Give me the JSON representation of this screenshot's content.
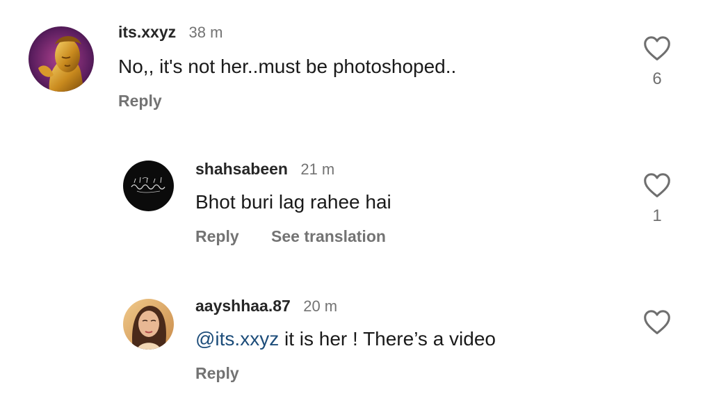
{
  "comments": [
    {
      "username": "its.xxyz",
      "time": "38 m",
      "text": "No,, it's not her..must be photoshoped..",
      "reply_label": "Reply",
      "like_count": "6",
      "avatar_icon": "golden-buddha-avatar"
    },
    {
      "username": "shahsabeen",
      "time": "21 m",
      "text": "Bhot buri lag rahee hai",
      "reply_label": "Reply",
      "translate_label": "See translation",
      "like_count": "1",
      "avatar_icon": "arabic-calligraphy-avatar"
    },
    {
      "username": "aayshhaa.87",
      "time": "20 m",
      "mention": "@its.xxyz",
      "text_rest": " it is her ! There’s a video",
      "reply_label": "Reply",
      "avatar_icon": "woman-portrait-avatar"
    }
  ],
  "colors": {
    "mention": "#1d4d7a",
    "muted": "#737373",
    "username": "#262626"
  }
}
